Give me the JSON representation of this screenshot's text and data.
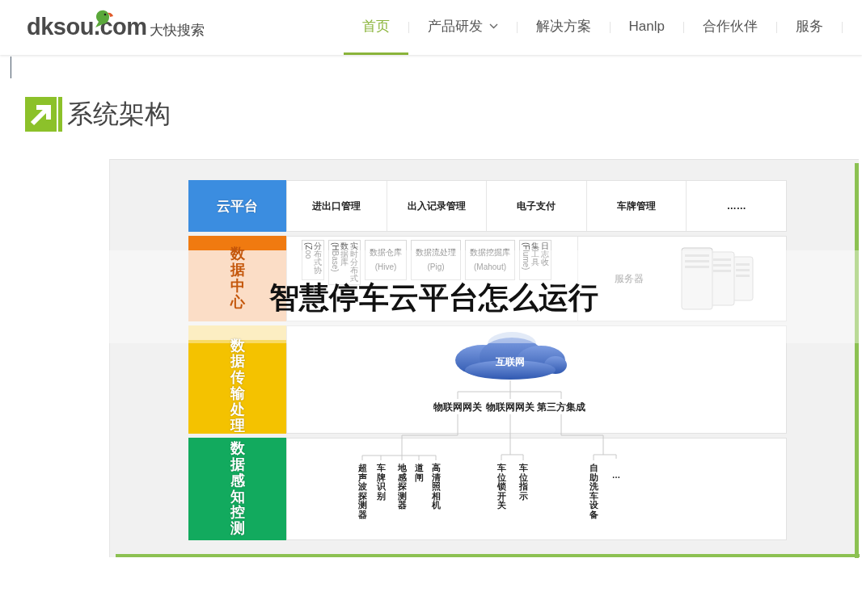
{
  "header": {
    "logo": {
      "name": "dksou.com",
      "tagline": "大快搜索"
    },
    "nav": [
      {
        "label": "首页",
        "selected": true,
        "has_menu": false
      },
      {
        "label": "产品研发",
        "selected": false,
        "has_menu": true
      },
      {
        "label": "解决方案",
        "selected": false,
        "has_menu": false
      },
      {
        "label": "Hanlp",
        "selected": false,
        "has_menu": false
      },
      {
        "label": "合作伙伴",
        "selected": false,
        "has_menu": false
      },
      {
        "label": "服务",
        "selected": false,
        "has_menu": false
      }
    ]
  },
  "section": {
    "title": "系统架构"
  },
  "diagram": {
    "layers": [
      {
        "kind": "modules",
        "label": "云平台",
        "color": "#3b8de0",
        "modules": [
          "进出口管理",
          "出入记录管理",
          "电子支付",
          "车牌管理",
          "……"
        ]
      },
      {
        "kind": "storage",
        "label": "数据中心",
        "color": "#f07a10",
        "components": [
          {
            "kind": "vertical",
            "columns": [
              "分布式协"
            ],
            "note": "(Zoo"
          },
          {
            "kind": "vertical",
            "columns": [
              "数据库",
              "实时分布式"
            ],
            "note": "(HBase)"
          },
          {
            "kind": "horizontal",
            "columns": [
              "数据仓库"
            ],
            "note": "(Hive)"
          },
          {
            "kind": "horizontal",
            "columns": [
              "数据流处理"
            ],
            "note": "(Pig)"
          },
          {
            "kind": "horizontal",
            "columns": [
              "数据挖掘库"
            ],
            "note": "(Mahout)"
          },
          {
            "kind": "vertical",
            "columns": [
              "集工具",
              "日志收"
            ],
            "note": "(Flume)"
          }
        ],
        "server_label": "服务器"
      },
      {
        "kind": "network",
        "label": "数据传输处理",
        "color": "#f4c200",
        "cloud": "互联网",
        "gateways": [
          "物联网网关",
          "物联网网关",
          "第三方集成"
        ]
      },
      {
        "kind": "sensors",
        "label": "数据感知控测",
        "color": "#12aa5e",
        "groups": [
          [
            {
              "kind": "vertical",
              "text": "超声波探测器"
            },
            {
              "kind": "vertical",
              "text": "车牌识别"
            },
            {
              "kind": "vertical",
              "text": "地感探测器"
            },
            {
              "kind": "vertical",
              "text": "道闸"
            },
            {
              "kind": "vertical",
              "text": "高清照相机"
            }
          ],
          [
            {
              "kind": "vertical",
              "text": "车位锁开关"
            },
            {
              "kind": "vertical",
              "text": "车位指示"
            }
          ],
          [
            {
              "kind": "vertical",
              "text": "自助洗车设备"
            },
            {
              "kind": "horizontal",
              "text": "…"
            }
          ]
        ]
      }
    ]
  },
  "banner": {
    "title": "智慧停车云平台怎么运行"
  }
}
